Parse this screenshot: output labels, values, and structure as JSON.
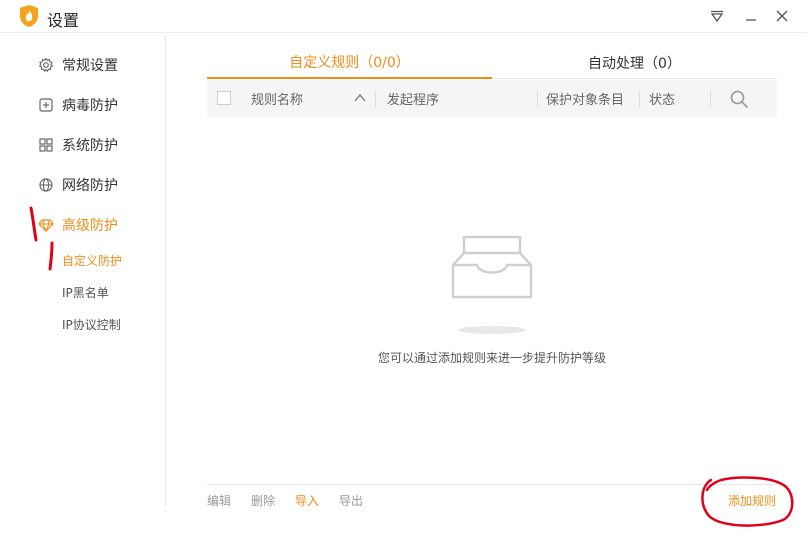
{
  "window": {
    "title": "设置",
    "icons": {
      "logo": "flame-shield-logo",
      "menu": "menu-down-icon",
      "minimize": "minimize-icon",
      "close": "close-icon"
    }
  },
  "sidebar": {
    "items": [
      {
        "label": "常规设置",
        "icon": "gear-icon"
      },
      {
        "label": "病毒防护",
        "icon": "plus-square-icon"
      },
      {
        "label": "系统防护",
        "icon": "grid-icon"
      },
      {
        "label": "网络防护",
        "icon": "globe-icon"
      },
      {
        "label": "高级防护",
        "icon": "diamond-icon",
        "active": true
      }
    ],
    "sub_items": [
      {
        "label": "自定义防护",
        "active": true
      },
      {
        "label": "IP黑名单"
      },
      {
        "label": "IP协议控制"
      }
    ]
  },
  "tabs": [
    {
      "label": "自定义规则（0/0）",
      "active": true
    },
    {
      "label": "自动处理（0）"
    }
  ],
  "table": {
    "columns": [
      "规则名称",
      "发起程序",
      "保护对象条目",
      "状态"
    ],
    "rows": []
  },
  "empty": {
    "message": "您可以通过添加规则来进一步提升防护等级"
  },
  "footer": {
    "buttons": [
      "编辑",
      "删除",
      "导入",
      "导出"
    ],
    "add_rule": "添加规则"
  },
  "colors": {
    "accent": "#f08d18",
    "annotation": "#e0001a"
  }
}
